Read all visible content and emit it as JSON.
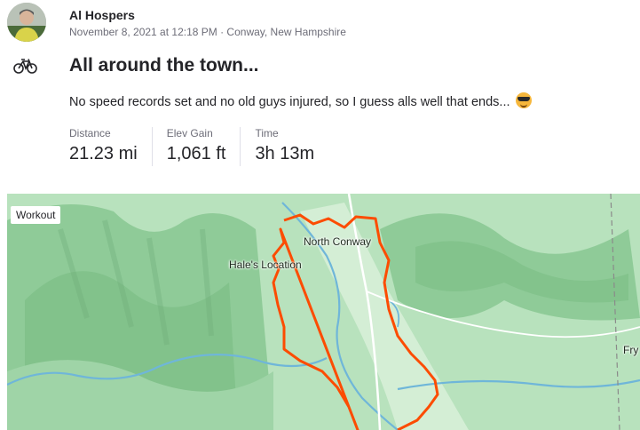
{
  "athlete": {
    "name": "Al Hospers"
  },
  "activity": {
    "meta": "November 8, 2021 at 12:18 PM · Conway, New Hampshire",
    "type_icon": "bike-icon",
    "title": "All around the town...",
    "description": "No speed records set and no old guys injured, so I guess alls well that ends...",
    "description_emoji": "smiling-face-with-sunglasses"
  },
  "stats": [
    {
      "label": "Distance",
      "value": "21.23 mi"
    },
    {
      "label": "Elev Gain",
      "value": "1,061 ft"
    },
    {
      "label": "Time",
      "value": "3h 13m"
    }
  ],
  "map": {
    "badge": "Workout",
    "labels": [
      "North Conway",
      "Hale's Location",
      "Fry"
    ],
    "route_color": "#fc4c02",
    "terrain_color": "#9dd3a6",
    "water_color": "#6fb6d9"
  }
}
